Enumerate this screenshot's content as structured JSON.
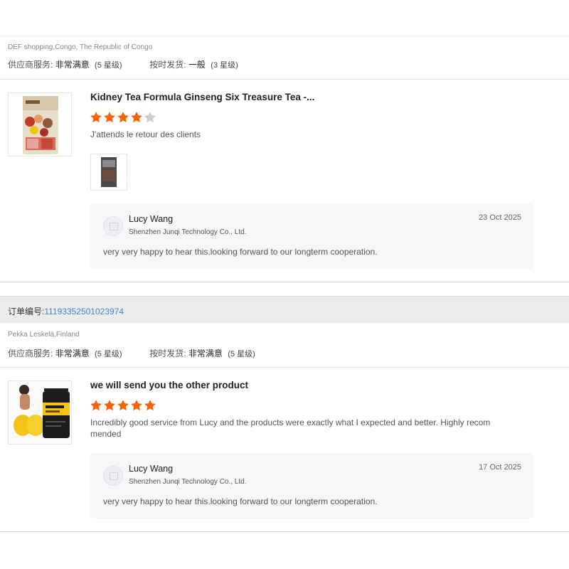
{
  "reviews": [
    {
      "buyer": "DEF shopping,Congo, The Republic of Congo",
      "supplier_service_label": "供应商服务:",
      "supplier_service_value": "非常满意",
      "supplier_service_level": "(5 星级)",
      "on_time_label": "按时发货:",
      "on_time_value": "一般",
      "on_time_level": "(3 星级)",
      "title": "Kidney Tea Formula Ginseng Six Treasure Tea -...",
      "rating": 4,
      "text": "J'attends le retour des clients",
      "has_photo": true,
      "product_icon": "tea-bag-package-image",
      "reply": {
        "name": "Lucy Wang",
        "company": "Shenzhen Junqi Technology Co., Ltd.",
        "date": "23 Oct 2025",
        "message": "very very happy to hear this.looking forward to our longterm cooperation."
      }
    },
    {
      "buyer": "Pekka Leskelä,Finland",
      "supplier_service_label": "供应商服务:",
      "supplier_service_value": "非常满意",
      "supplier_service_level": "(5 星级)",
      "on_time_label": "按时发货:",
      "on_time_value": "非常满意",
      "on_time_level": "(5 星级)",
      "title": "we will send you the other product",
      "rating": 5,
      "text": "Incredibly good service from Lucy and the products were exactly what I expected and better. Highly recom mended",
      "has_photo": false,
      "product_icon": "hip-butt-supplement-image",
      "reply": {
        "name": "Lucy Wang",
        "company": "Shenzhen Junqi Technology Co., Ltd.",
        "date": "17 Oct 2025",
        "message": "very very happy to hear this.looking forward to our longterm cooperation."
      }
    }
  ],
  "order": {
    "label": "订单编号:",
    "number": "11193352501023974"
  },
  "colors": {
    "star_filled": "#f5640a",
    "star_empty": "#cccccc",
    "order_link": "#3d86d8",
    "reply_bg": "#f6f7f9"
  }
}
